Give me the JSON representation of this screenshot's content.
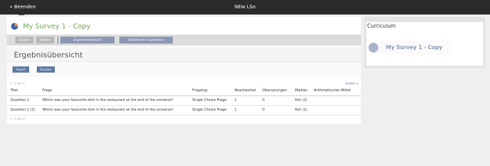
{
  "topbar": {
    "back_label": "« Beenden",
    "title": "NEw LSo"
  },
  "survey": {
    "name": "My Survey 1 - Copy",
    "icon": "survey-pie-icon"
  },
  "toolbar": {
    "back": "Zurück",
    "next": "Weiter",
    "tab_overview": "Ergebnisübersicht",
    "tab_details": "Detaillierte Ergebnisse"
  },
  "page_title": "Ergebnisübersicht",
  "actions": {
    "export": "Export",
    "print": "Drucken"
  },
  "table": {
    "range_top": "1 - 2 von 2",
    "range_bottom": "1 - 2 von 2",
    "columns_link": "Spalten ▾",
    "headers": [
      "Titel",
      "Frage",
      "Fragetyp",
      "Beantwortet",
      "Übersprungen",
      "Median",
      "Arithmetisches Mittel"
    ],
    "rows": [
      [
        "Question 1",
        "Which was your favourite dish in the restaurant at the end of the universe?",
        "Single Choice Frage",
        "1",
        "0",
        "fish (1)",
        ""
      ],
      [
        "Question 1 (2)",
        "Which was your favourite dish in the restaurant at the end of the universe?",
        "Single Choice Frage",
        "1",
        "0",
        "fish (1)",
        ""
      ]
    ]
  },
  "sidebar": {
    "title": "Curriculum",
    "item_label": "My Survey 1 - Copy"
  },
  "colors": {
    "topbar": "#2b2b2b",
    "survey_title": "#6aa84f",
    "button": "#5f7aa5",
    "tab": "#8b98b5"
  }
}
